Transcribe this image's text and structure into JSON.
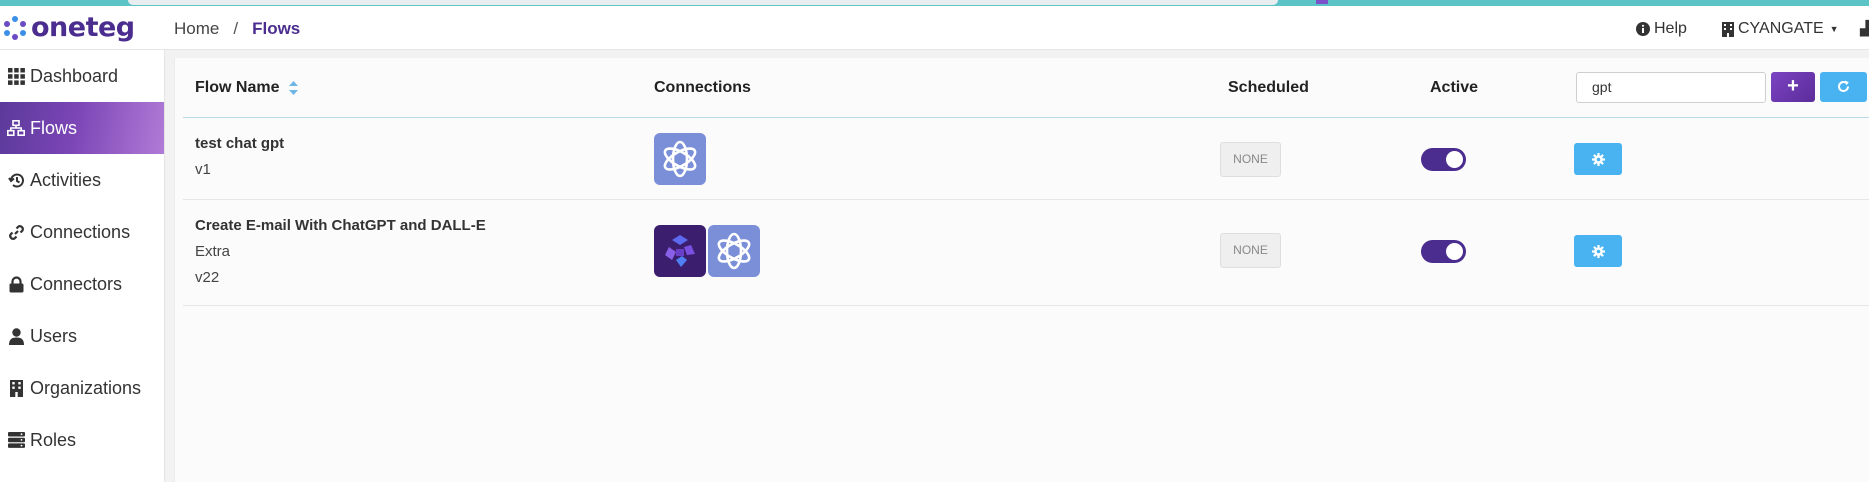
{
  "app": {
    "logo_text": "oneteg",
    "brand_color": "#4b2d8f",
    "accent_color": "#49b3f2"
  },
  "header": {
    "breadcrumb": {
      "home": "Home",
      "separator": "/",
      "current": "Flows"
    },
    "help_label": "Help",
    "org_label": "CYANGATE"
  },
  "sidebar": {
    "items": [
      {
        "label": "Dashboard",
        "icon": "grid-icon"
      },
      {
        "label": "Flows",
        "icon": "sitemap-icon",
        "active": true
      },
      {
        "label": "Activities",
        "icon": "history-icon"
      },
      {
        "label": "Connections",
        "icon": "link-icon"
      },
      {
        "label": "Connectors",
        "icon": "lock-icon"
      },
      {
        "label": "Users",
        "icon": "user-icon"
      },
      {
        "label": "Organizations",
        "icon": "building-icon"
      },
      {
        "label": "Roles",
        "icon": "server-icon"
      }
    ]
  },
  "table": {
    "columns": {
      "flow_name": "Flow Name",
      "connections": "Connections",
      "scheduled": "Scheduled",
      "active": "Active"
    },
    "search": {
      "value": "gpt"
    },
    "rows": [
      {
        "name": "test chat gpt",
        "lines": [
          "v1"
        ],
        "connections": [
          "openai-icon"
        ],
        "scheduled": "NONE",
        "active": true
      },
      {
        "name": "Create E-mail With ChatGPT and DALL-E",
        "lines": [
          "Extra",
          "v22"
        ],
        "connections": [
          "dalle-icon",
          "openai-icon"
        ],
        "scheduled": "NONE",
        "active": true
      }
    ]
  }
}
